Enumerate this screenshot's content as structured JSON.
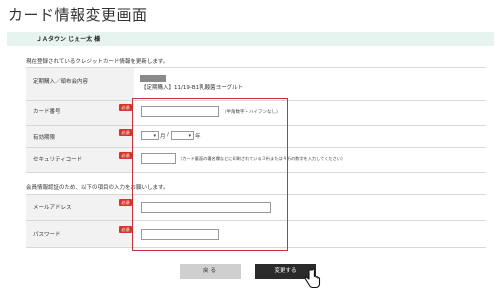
{
  "page": {
    "title": "カード情報変更画面"
  },
  "user": {
    "name": "ＪＡタウン じぇー太 様"
  },
  "intro": "現在登録されているクレジットカード情報を更新します。",
  "section2": "会員情報認証のため、以下の項目の入力をお願いします。",
  "required_badge": "必須",
  "rows": {
    "purchase": {
      "label": "定期購入／頒布会内容",
      "value": "【定期購入】11/19-B1乳酸菌ヨーグルト"
    },
    "card_number": {
      "label": "カード番号",
      "hint": "（半角数字・ハイフンなし）"
    },
    "expiry": {
      "label": "有効期限",
      "month_unit": "月",
      "sep": "/",
      "year_unit": "年"
    },
    "security": {
      "label": "セキュリティコード",
      "hint": "（カード裏面の署名欄などに印刷されている３桁または４桁の数字を入力してください）"
    },
    "email": {
      "label": "メールアドレス"
    },
    "password": {
      "label": "パスワード"
    }
  },
  "buttons": {
    "back": "戻る",
    "change": "変更する"
  },
  "colors": {
    "accent_red": "#c8323a",
    "user_bar": "#e6f3ee",
    "button_dark": "#2a2a2a"
  }
}
